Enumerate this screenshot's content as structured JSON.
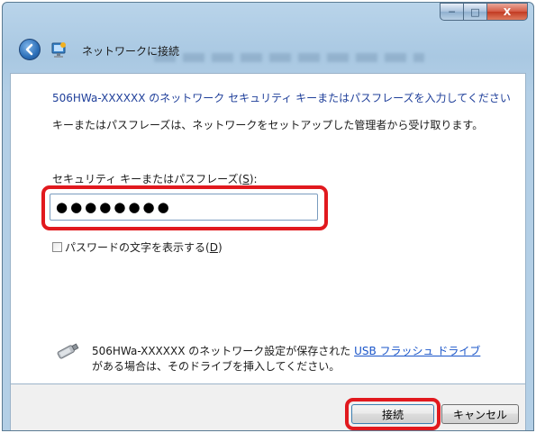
{
  "window": {
    "title": "ネットワークに接続"
  },
  "dialog": {
    "heading": "506HWa-XXXXXX のネットワーク セキュリティ キーまたはパスフレーズを入力してください",
    "description": "キーまたはパスフレーズは、ネットワークをセットアップした管理者から受け取ります。",
    "passphrase_label": "セキュリティ キーまたはパスフレーズ(",
    "passphrase_label_key": "S",
    "passphrase_label_end": "):",
    "passphrase_value": "●●●●●●●●",
    "show_characters_label": "パスワードの文字を表示する(",
    "show_characters_key": "D",
    "show_characters_end": ")",
    "show_characters_checked": false,
    "usb_text_prefix": "506HWa-XXXXXX のネットワーク設定が保存された ",
    "usb_link": "USB フラッシュ ドライブ",
    "usb_text_line2": "がある場合は、そのドライブを挿入してください。"
  },
  "buttons": {
    "connect": "接続",
    "cancel": "キャンセル",
    "minimize": "─",
    "maximize": "□",
    "close": "X"
  },
  "colors": {
    "heading": "#1f3f9a",
    "highlight": "#e1191e",
    "link": "#1a55c9",
    "window_frame": "#a9c8e2"
  },
  "icons": {
    "back": "back-arrow-icon",
    "network": "network-wizard-icon",
    "usb": "usb-drive-icon"
  }
}
